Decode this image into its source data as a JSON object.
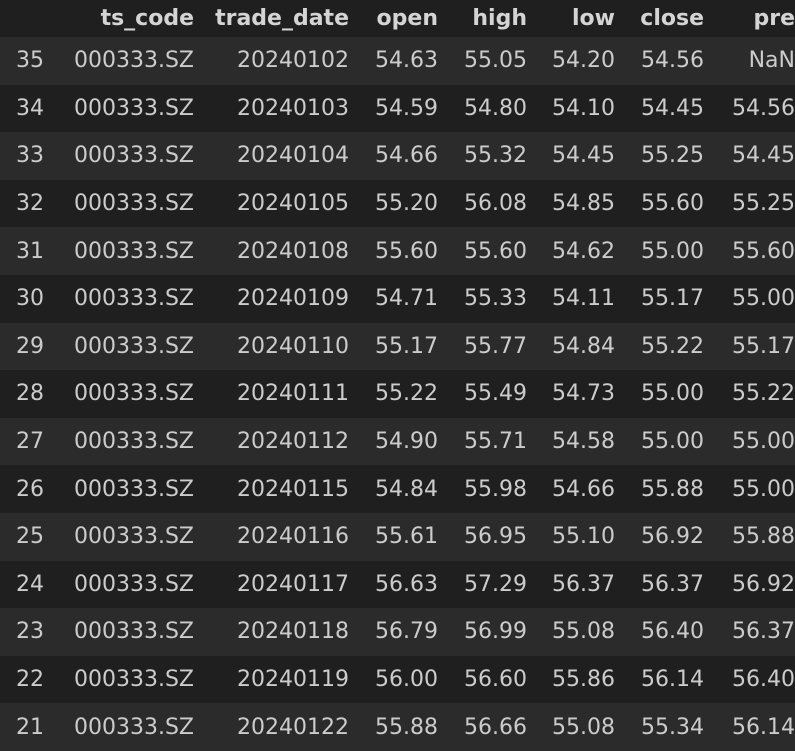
{
  "table": {
    "columns": [
      "",
      "ts_code",
      "trade_date",
      "open",
      "high",
      "low",
      "close",
      "pre"
    ],
    "rows": [
      {
        "idx": "35",
        "ts_code": "000333.SZ",
        "trade_date": "20240102",
        "open": "54.63",
        "high": "55.05",
        "low": "54.20",
        "close": "54.56",
        "pre": "NaN"
      },
      {
        "idx": "34",
        "ts_code": "000333.SZ",
        "trade_date": "20240103",
        "open": "54.59",
        "high": "54.80",
        "low": "54.10",
        "close": "54.45",
        "pre": "54.56"
      },
      {
        "idx": "33",
        "ts_code": "000333.SZ",
        "trade_date": "20240104",
        "open": "54.66",
        "high": "55.32",
        "low": "54.45",
        "close": "55.25",
        "pre": "54.45"
      },
      {
        "idx": "32",
        "ts_code": "000333.SZ",
        "trade_date": "20240105",
        "open": "55.20",
        "high": "56.08",
        "low": "54.85",
        "close": "55.60",
        "pre": "55.25"
      },
      {
        "idx": "31",
        "ts_code": "000333.SZ",
        "trade_date": "20240108",
        "open": "55.60",
        "high": "55.60",
        "low": "54.62",
        "close": "55.00",
        "pre": "55.60"
      },
      {
        "idx": "30",
        "ts_code": "000333.SZ",
        "trade_date": "20240109",
        "open": "54.71",
        "high": "55.33",
        "low": "54.11",
        "close": "55.17",
        "pre": "55.00"
      },
      {
        "idx": "29",
        "ts_code": "000333.SZ",
        "trade_date": "20240110",
        "open": "55.17",
        "high": "55.77",
        "low": "54.84",
        "close": "55.22",
        "pre": "55.17"
      },
      {
        "idx": "28",
        "ts_code": "000333.SZ",
        "trade_date": "20240111",
        "open": "55.22",
        "high": "55.49",
        "low": "54.73",
        "close": "55.00",
        "pre": "55.22"
      },
      {
        "idx": "27",
        "ts_code": "000333.SZ",
        "trade_date": "20240112",
        "open": "54.90",
        "high": "55.71",
        "low": "54.58",
        "close": "55.00",
        "pre": "55.00"
      },
      {
        "idx": "26",
        "ts_code": "000333.SZ",
        "trade_date": "20240115",
        "open": "54.84",
        "high": "55.98",
        "low": "54.66",
        "close": "55.88",
        "pre": "55.00"
      },
      {
        "idx": "25",
        "ts_code": "000333.SZ",
        "trade_date": "20240116",
        "open": "55.61",
        "high": "56.95",
        "low": "55.10",
        "close": "56.92",
        "pre": "55.88"
      },
      {
        "idx": "24",
        "ts_code": "000333.SZ",
        "trade_date": "20240117",
        "open": "56.63",
        "high": "57.29",
        "low": "56.37",
        "close": "56.37",
        "pre": "56.92"
      },
      {
        "idx": "23",
        "ts_code": "000333.SZ",
        "trade_date": "20240118",
        "open": "56.79",
        "high": "56.99",
        "low": "55.08",
        "close": "56.40",
        "pre": "56.37"
      },
      {
        "idx": "22",
        "ts_code": "000333.SZ",
        "trade_date": "20240119",
        "open": "56.00",
        "high": "56.60",
        "low": "55.86",
        "close": "56.14",
        "pre": "56.40"
      },
      {
        "idx": "21",
        "ts_code": "000333.SZ",
        "trade_date": "20240122",
        "open": "55.88",
        "high": "56.66",
        "low": "55.08",
        "close": "55.34",
        "pre": "56.14"
      }
    ]
  },
  "colors": {
    "background": "#1f1f1f",
    "stripe": "#2b2b2b",
    "text": "#cccccc"
  }
}
